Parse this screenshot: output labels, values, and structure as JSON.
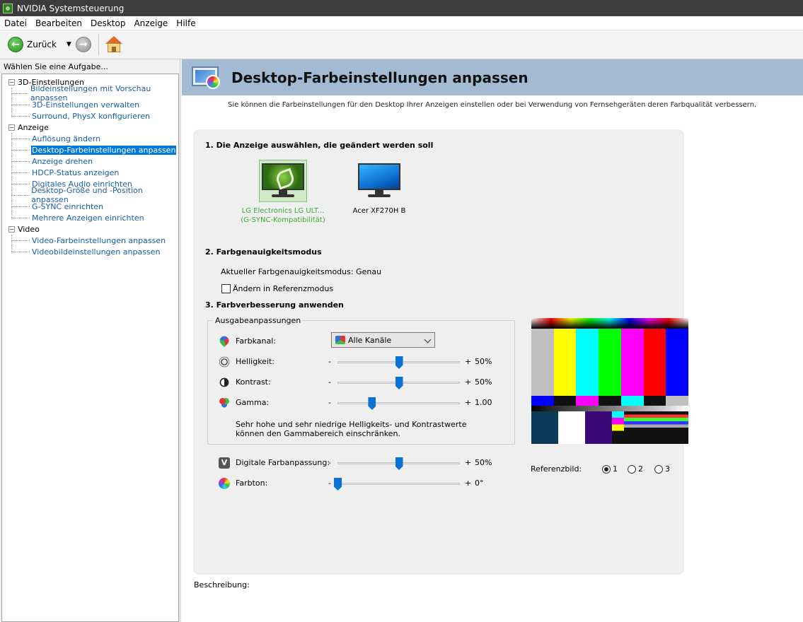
{
  "window": {
    "title": "NVIDIA Systemsteuerung"
  },
  "menu": [
    "Datei",
    "Bearbeiten",
    "Desktop",
    "Anzeige",
    "Hilfe"
  ],
  "toolbar": {
    "back_label": "Zurück"
  },
  "sidebar": {
    "header": "Wählen Sie eine Aufgabe...",
    "groups": [
      {
        "label": "3D-Einstellungen",
        "items": [
          "Bildeinstellungen mit Vorschau anpassen",
          "3D-Einstellungen verwalten",
          "Surround, PhysX konfigurieren"
        ]
      },
      {
        "label": "Anzeige",
        "items": [
          "Auflösung ändern",
          "Desktop-Farbeinstellungen anpassen",
          "Anzeige drehen",
          "HDCP-Status anzeigen",
          "Digitales Audio einrichten",
          "Desktop-Größe und -Position anpassen",
          "G-SYNC einrichten",
          "Mehrere Anzeigen einrichten"
        ]
      },
      {
        "label": "Video",
        "items": [
          "Video-Farbeinstellungen anpassen",
          "Videobildeinstellungen anpassen"
        ]
      }
    ],
    "selected": "Desktop-Farbeinstellungen anpassen"
  },
  "page": {
    "title": "Desktop-Farbeinstellungen anpassen",
    "intro": "Sie können die Farbeinstellungen für den Desktop Ihrer Anzeigen einstellen oder bei Verwendung von Fernsehgeräten deren Farbqualität verbessern.",
    "section1": "1. Die Anzeige auswählen, die geändert werden soll",
    "displays": [
      {
        "name_line1": "LG Electronics LG ULT...",
        "name_line2": "(G-SYNC-Kompatibilität)",
        "selected": true
      },
      {
        "name_line1": "Acer XF270H B",
        "name_line2": "",
        "selected": false
      }
    ],
    "section2": "2. Farbgenauigkeitsmodus",
    "current_mode": "Aktueller Farbgenauigkeitsmodus: Genau",
    "reference_mode_checkbox": "Ändern in Referenzmodus",
    "reference_mode_checked": false,
    "section3": "3. Farbverbesserung anwenden",
    "output_group": "Ausgabeanpassungen",
    "channel_label": "Farbkanal:",
    "channel_value": "Alle Kanäle",
    "sliders": {
      "brightness": {
        "label": "Helligkeit:",
        "value": "50%",
        "fraction": 0.5
      },
      "contrast": {
        "label": "Kontrast:",
        "value": "50%",
        "fraction": 0.5
      },
      "gamma": {
        "label": "Gamma:",
        "value": "1.00",
        "fraction": 0.28
      },
      "vibrance": {
        "label": "Digitale Farbanpassung:",
        "value": "50%",
        "fraction": 0.5
      },
      "hue": {
        "label": "Farbton:",
        "value": "0°",
        "fraction": 0.0
      }
    },
    "minus": "-",
    "plus": "+",
    "help_line1": "Sehr hohe und sehr niedrige Helligkeits- und Kontrastwerte",
    "help_line2": "können den Gammabereich einschränken.",
    "reference_label": "Referenzbild:",
    "reference_options": [
      "1",
      "2",
      "3"
    ],
    "reference_selected": "1",
    "description_label": "Beschreibung:"
  },
  "colors": {
    "banner": "#a3bad3",
    "accent": "#0a72d6",
    "selected_display_text": "#3aaa35",
    "link": "#1a5ea8",
    "test_bars": [
      "#c0c0c0",
      "#ffff00",
      "#00ffff",
      "#00ff00",
      "#ff00ff",
      "#ff0000",
      "#0000ff"
    ]
  }
}
